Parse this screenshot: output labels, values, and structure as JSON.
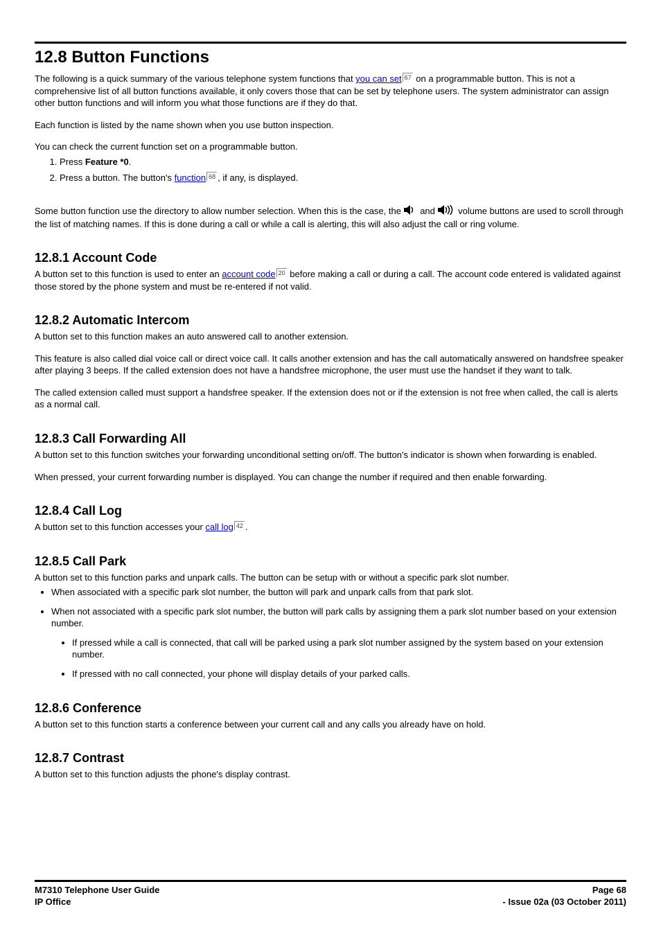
{
  "title": "12.8 Button Functions",
  "intro1a": "The following is a quick summary of the various telephone system functions that ",
  "intro1_link": "you can set",
  "intro1_ref": "67",
  "intro1b": " on a programmable button. This is not a comprehensive list of all button functions available, it only covers those that can be set by telephone users. The system administrator can assign other button functions and will inform you what those functions are if they do that.",
  "intro2": "Each function is listed by the name shown when you use button inspection.",
  "intro3": "You can check the current function set on a programmable button.",
  "steps": {
    "s1a": "Press ",
    "s1b": "Feature *0",
    "s1c": ".",
    "s2a": "Press a button. The button's ",
    "s2_link": "function",
    "s2_ref": "68",
    "s2b": ", if any, is displayed."
  },
  "volume_a": "Some button function use the directory to allow number selection. When this is the case, the ",
  "volume_mid": " and ",
  "volume_b": " volume buttons are used to scroll through the list of matching names. If this is done during a call or while a call is alerting, this will also adjust the call or ring volume.",
  "sections": {
    "s1": {
      "title": "12.8.1 Account Code",
      "p1a": "A button set to this function is used to enter an ",
      "p1_link": "account code",
      "p1_ref": "20",
      "p1b": " before making a call or during a call. The account code entered is validated against those stored by the phone system and must be re-entered if not valid."
    },
    "s2": {
      "title": "12.8.2 Automatic Intercom",
      "p1": "A button set to this function makes an auto answered call to another extension.",
      "p2": "This feature is also called dial voice call or direct voice call. It calls another extension and has the call automatically answered on handsfree speaker after playing 3 beeps. If the called extension does not have a handsfree microphone, the user must use the handset if they want to talk.",
      "p3": "The called extension called must support a handsfree speaker. If the extension does not or if the extension is not free when called, the call is alerts as a normal call."
    },
    "s3": {
      "title": "12.8.3 Call Forwarding All",
      "p1": "A button set to this function switches your forwarding unconditional setting on/off. The button's indicator is shown when forwarding is enabled.",
      "p2": "When pressed, your current forwarding number is displayed. You can change the number if required and then enable forwarding."
    },
    "s4": {
      "title": "12.8.4 Call Log",
      "p1a": "A button set to this function accesses your ",
      "p1_link": "call log",
      "p1_ref": "42",
      "p1b": "."
    },
    "s5": {
      "title": "12.8.5 Call Park",
      "p1": "A button set to this function parks and unpark calls. The button can be setup with or without a specific park slot number.",
      "b1": "When associated with a specific park slot number, the button will park and unpark calls from that park slot.",
      "b2": "When not associated with a specific park slot number, the button will park calls by assigning them a park slot number based on your extension number.",
      "b2a": "If pressed while a call is connected, that call will be parked using a park slot number assigned by the system based on your extension number.",
      "b2b": "If pressed with no call connected, your phone will display details of your parked calls."
    },
    "s6": {
      "title": "12.8.6 Conference",
      "p1": "A button set to this function starts a conference between your current call and any calls you already have on hold."
    },
    "s7": {
      "title": "12.8.7 Contrast",
      "p1": "A button set to this function adjusts the phone's display contrast."
    }
  },
  "footer": {
    "left1": "M7310 Telephone User Guide",
    "right1": "Page 68",
    "left2": "IP Office",
    "right2": "- Issue 02a (03 October 2011)"
  }
}
